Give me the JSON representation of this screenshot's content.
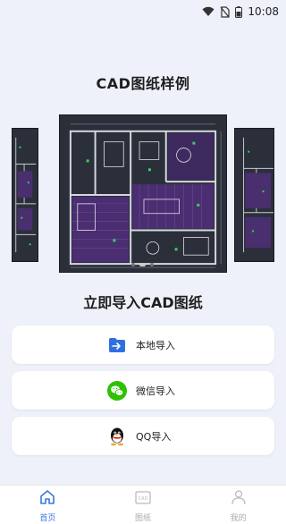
{
  "status_bar": {
    "time": "10:08",
    "icons": [
      "wifi-icon",
      "no-sim-icon",
      "battery-icon"
    ]
  },
  "sample_section": {
    "title": "CAD图纸样例"
  },
  "carousel": {
    "slides": 3,
    "active_index": 1
  },
  "import_section": {
    "title": "立即导入CAD图纸",
    "buttons": [
      {
        "label": "本地导入",
        "icon": "folder-import-icon",
        "color": "#2f6fe0"
      },
      {
        "label": "微信导入",
        "icon": "wechat-icon",
        "color": "#2dc100"
      },
      {
        "label": "QQ导入",
        "icon": "qq-icon",
        "color": "#111111"
      }
    ]
  },
  "tab_bar": {
    "items": [
      {
        "label": "首页",
        "icon": "home-icon",
        "active": true
      },
      {
        "label": "图纸",
        "icon": "drawing-icon",
        "active": false
      },
      {
        "label": "我的",
        "icon": "profile-icon",
        "active": false
      }
    ],
    "active_color": "#3a78e0",
    "inactive_color": "#aaaaaa"
  }
}
